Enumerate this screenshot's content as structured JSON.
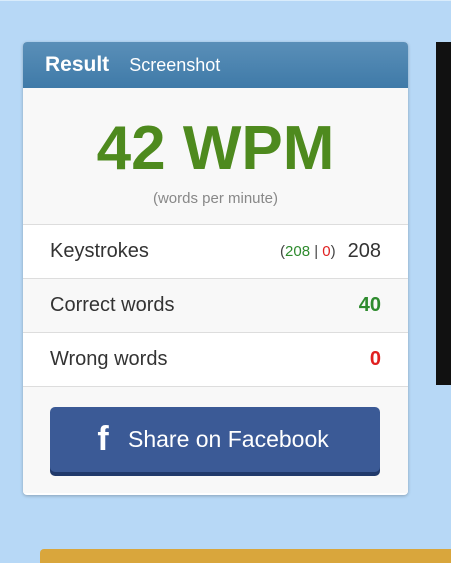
{
  "tabs": {
    "result": "Result",
    "screenshot": "Screenshot"
  },
  "wpm": {
    "value": "42 WPM",
    "subtitle": "(words per minute)"
  },
  "keystrokes": {
    "label": "Keystrokes",
    "open": "(",
    "correct": "208",
    "sep": " | ",
    "wrong": "0",
    "close": ")",
    "total": "208"
  },
  "correct_words": {
    "label": "Correct words",
    "value": "40"
  },
  "wrong_words": {
    "label": "Wrong words",
    "value": "0"
  },
  "share": {
    "icon_glyph": "f",
    "label": "Share on Facebook",
    "icon": "facebook-icon"
  },
  "colors": {
    "header": "#4682b4",
    "wpm": "#4e8a1e",
    "correct": "#2e8b2e",
    "wrong": "#e02020",
    "facebook": "#3b5a96"
  }
}
